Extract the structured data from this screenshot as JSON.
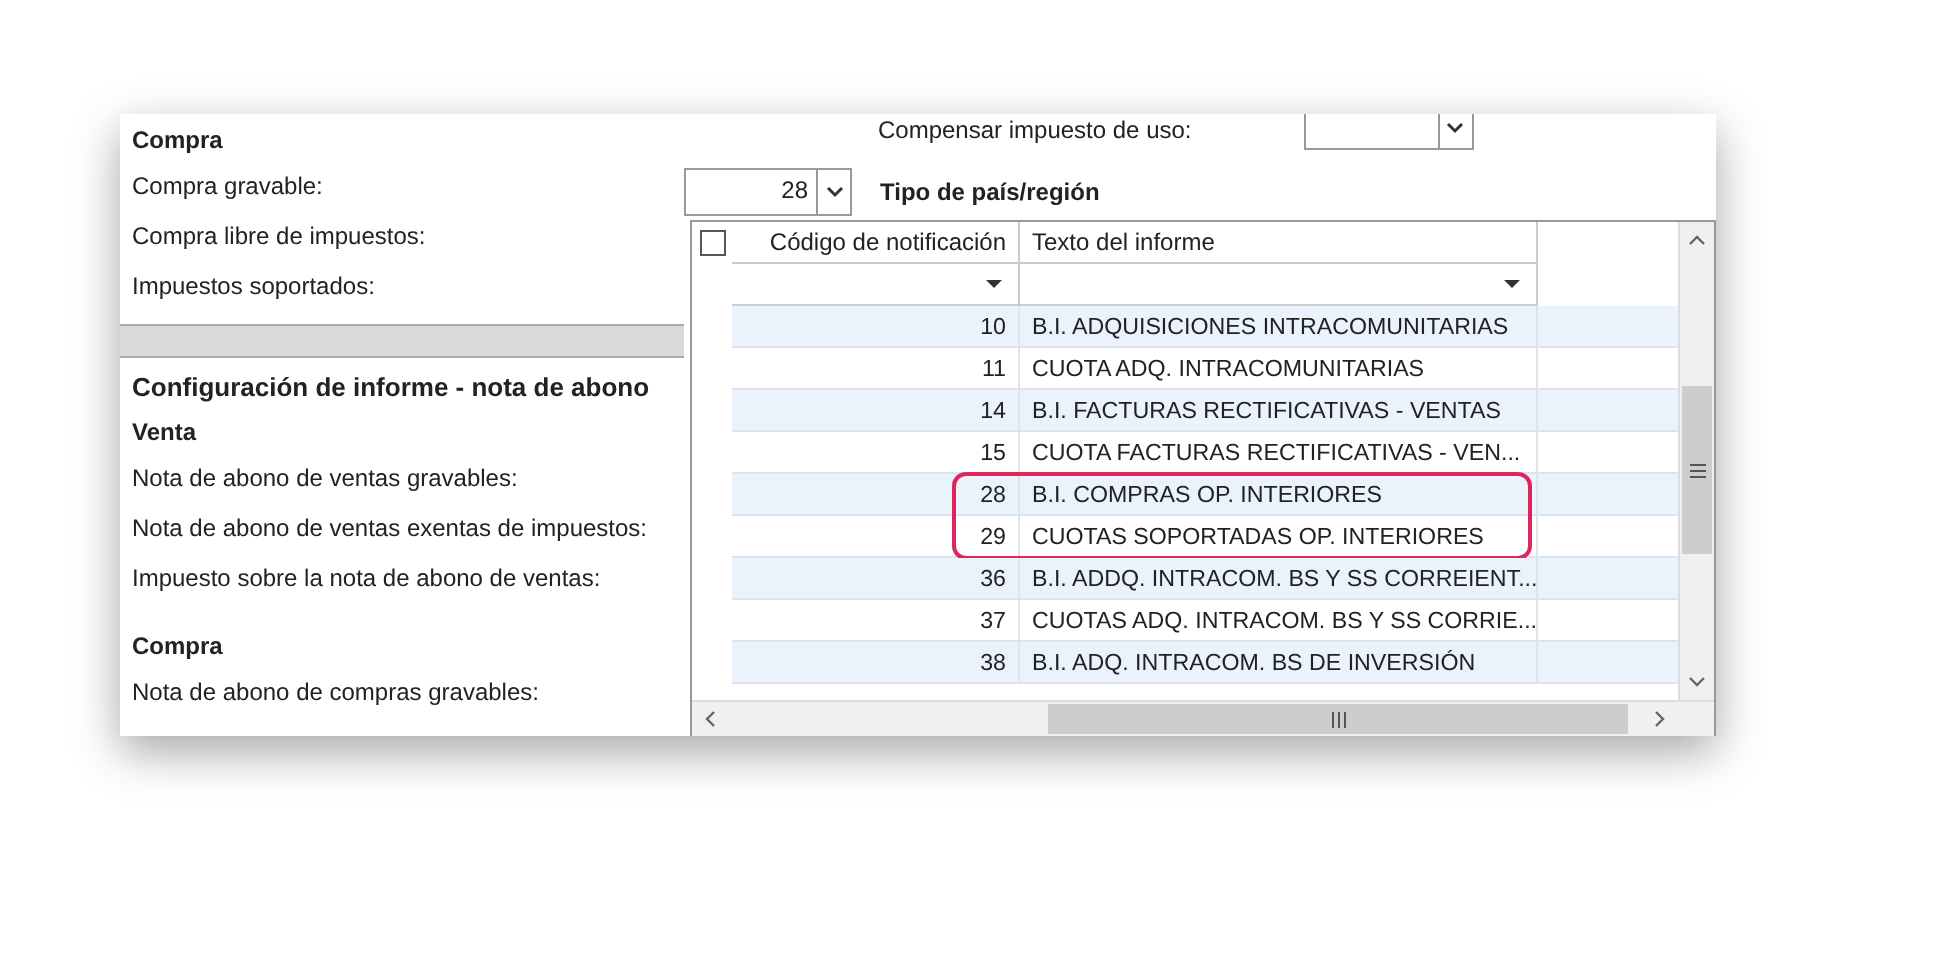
{
  "purchase": {
    "heading": "Compra",
    "fields": [
      "Compra gravable:",
      "Compra libre de impuestos:",
      "Impuestos soportados:"
    ]
  },
  "report_config": {
    "title": "Configuración de informe - nota de abono",
    "groups": [
      {
        "heading": "Venta",
        "fields": [
          "Nota de abono de ventas gravables:",
          "Nota de abono de ventas exentas de impuestos:",
          "Impuesto sobre la nota de abono de ventas:"
        ]
      },
      {
        "heading": "Compra",
        "fields": [
          "Nota de abono de compras gravables:"
        ]
      }
    ]
  },
  "use_tax": {
    "label": "Compensar impuesto de uso:"
  },
  "code_combo": {
    "value": "28"
  },
  "region_type": {
    "title": "Tipo de país/región"
  },
  "table": {
    "select_all_checked": false,
    "columns": [
      "Código de notificación",
      "Texto del informe"
    ],
    "rows": [
      {
        "code": "10",
        "text": "B.I. ADQUISICIONES INTRACOMUNITARIAS",
        "highlighted": false
      },
      {
        "code": "11",
        "text": "CUOTA ADQ. INTRACOMUNITARIAS",
        "highlighted": false
      },
      {
        "code": "14",
        "text": "B.I. FACTURAS RECTIFICATIVAS - VENTAS",
        "highlighted": false
      },
      {
        "code": "15",
        "text": "CUOTA FACTURAS RECTIFICATIVAS - VEN...",
        "highlighted": false
      },
      {
        "code": "28",
        "text": "B.I. COMPRAS OP. INTERIORES",
        "highlighted": true
      },
      {
        "code": "29",
        "text": "CUOTAS SOPORTADAS OP. INTERIORES",
        "highlighted": true
      },
      {
        "code": "36",
        "text": "B.I. ADDQ. INTRACOM. BS Y SS CORREIENT...",
        "highlighted": false
      },
      {
        "code": "37",
        "text": "CUOTAS ADQ. INTRACOM. BS Y SS CORRIE...",
        "highlighted": false
      },
      {
        "code": "38",
        "text": "B.I. ADQ. INTRACOM. BS DE INVERSIÓN",
        "highlighted": false
      }
    ]
  }
}
